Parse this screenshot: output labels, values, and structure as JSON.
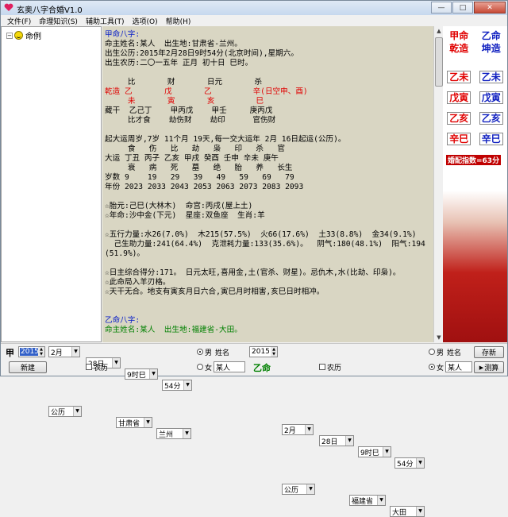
{
  "window": {
    "title": "玄奥八字合婚V1.0",
    "min": "—",
    "max": "□",
    "close": "✕"
  },
  "menu": [
    "文件(F)",
    "命理知识(S)",
    "辅助工具(T)",
    "选项(O)",
    "帮助(H)"
  ],
  "tree": {
    "toggle": "−",
    "root": "命例"
  },
  "content": {
    "lines": [
      {
        "t": "甲命八字:",
        "c": "blue"
      },
      {
        "t": "命主姓名:某人  出生地:甘肃省-兰州。",
        "c": ""
      },
      {
        "t": "出生公历:2015年2月28日9时54分(北京时间),星期六。",
        "c": ""
      },
      {
        "t": "出生农历:二〇一五年 正月 初十日 巳时。",
        "c": ""
      },
      {
        "t": "",
        "c": ""
      },
      {
        "t": "     比       财       日元       杀",
        "c": ""
      },
      {
        "t": "乾造 乙       戊       乙         辛(日空申、酉)",
        "c": "red"
      },
      {
        "t": "     未       寅       亥         巳",
        "c": "red"
      },
      {
        "t": "藏干  乙己丁    甲丙戊    甲壬     庚丙戊",
        "c": ""
      },
      {
        "t": "     比才食    劫伤财    劫印      官伤财",
        "c": ""
      },
      {
        "t": "",
        "c": ""
      },
      {
        "t": "起大运周岁,7岁 11个月 19天,每一交大运年 2月 16日起运(公历)。",
        "c": ""
      },
      {
        "t": "     食   伤   比   劫   枭   印   杀   官",
        "c": ""
      },
      {
        "t": "大运 丁丑 丙子 乙亥 甲戌 癸酉 壬申 辛未 庚午",
        "c": ""
      },
      {
        "t": "     衰   病   死   墓   绝   胎   养   长生",
        "c": ""
      },
      {
        "t": "岁数 9    19   29   39   49   59   69   79",
        "c": ""
      },
      {
        "t": "年份 2023 2033 2043 2053 2063 2073 2083 2093",
        "c": ""
      },
      {
        "t": "",
        "c": ""
      },
      {
        "t": "☆胎元:己巳(大林木)  命宫:丙戌(屋上土)",
        "c": ""
      },
      {
        "t": "☆年命:沙中金(下元)  星座:双鱼座  生肖:羊",
        "c": ""
      },
      {
        "t": "",
        "c": ""
      },
      {
        "t": "☆五行力量:水26(7.0%)  木215(57.5%)  火66(17.6%)  土33(8.8%)  金34(9.1%)",
        "c": ""
      },
      {
        "t": "  己生助力量:241(64.4%)  克泄耗力量:133(35.6%)。  阴气:180(48.1%)  阳气:194",
        "c": ""
      },
      {
        "t": "(51.9%)。",
        "c": ""
      },
      {
        "t": "",
        "c": ""
      },
      {
        "t": "☆日主综合得分:171。 日元太旺,喜用金,土(官杀、财星)。忌仇木,水(比劫、印枭)。",
        "c": ""
      },
      {
        "t": "☆此命局入羊刃格。",
        "c": ""
      },
      {
        "t": "☆天干无合。地支有寅亥月日六合,寅巳月时相害,亥巳日时相冲。",
        "c": ""
      },
      {
        "t": "",
        "c": ""
      },
      {
        "t": "",
        "c": ""
      },
      {
        "t": "乙命八字:",
        "c": "blue"
      },
      {
        "t": "命主姓名:某人  出生地:福建省-大田。",
        "c": "green"
      }
    ]
  },
  "scroll": {
    "up": "▲",
    "down": "▼"
  },
  "right_panel": {
    "header": [
      {
        "t": "甲命",
        "c": "red"
      },
      {
        "t": "乙命",
        "c": "blue"
      }
    ],
    "zaos": [
      {
        "t": "乾造",
        "c": "red"
      },
      {
        "t": "坤造",
        "c": "blue"
      }
    ],
    "pillars": [
      [
        {
          "t": "乙未",
          "c": "red"
        },
        {
          "t": "乙未",
          "c": "blue"
        }
      ],
      [
        {
          "t": "戊寅",
          "c": "red"
        },
        {
          "t": "戊寅",
          "c": "blue"
        }
      ],
      [
        {
          "t": "乙亥",
          "c": "red"
        },
        {
          "t": "乙亥",
          "c": "blue"
        }
      ],
      [
        {
          "t": "辛巳",
          "c": "red"
        },
        {
          "t": "辛巳",
          "c": "blue"
        }
      ]
    ],
    "score": "婚配指数=63分"
  },
  "bottom": {
    "jia_label": "甲",
    "yi_label": "乙命",
    "left": {
      "year": "2015",
      "month": "2月",
      "day": "28日",
      "hour": "9时巳",
      "minute": "54分",
      "male": "男",
      "female": "女",
      "name_label": "姓名",
      "name": "某人",
      "calendar": "公历",
      "lunar": "农历",
      "province": "甘肃省",
      "city": "兰州"
    },
    "right": {
      "year": "2015",
      "month": "2月",
      "day": "28日",
      "hour": "9时巳",
      "minute": "54分",
      "male": "男",
      "female": "女",
      "name_label": "姓名",
      "name": "某人",
      "calendar": "公历",
      "lunar": "农历",
      "province": "福建省",
      "city": "大田"
    },
    "new_button": "新建",
    "save_button": "存新",
    "calc_button": "测算",
    "colors": {
      "jia": "#e00000",
      "yi": "#008000"
    }
  }
}
